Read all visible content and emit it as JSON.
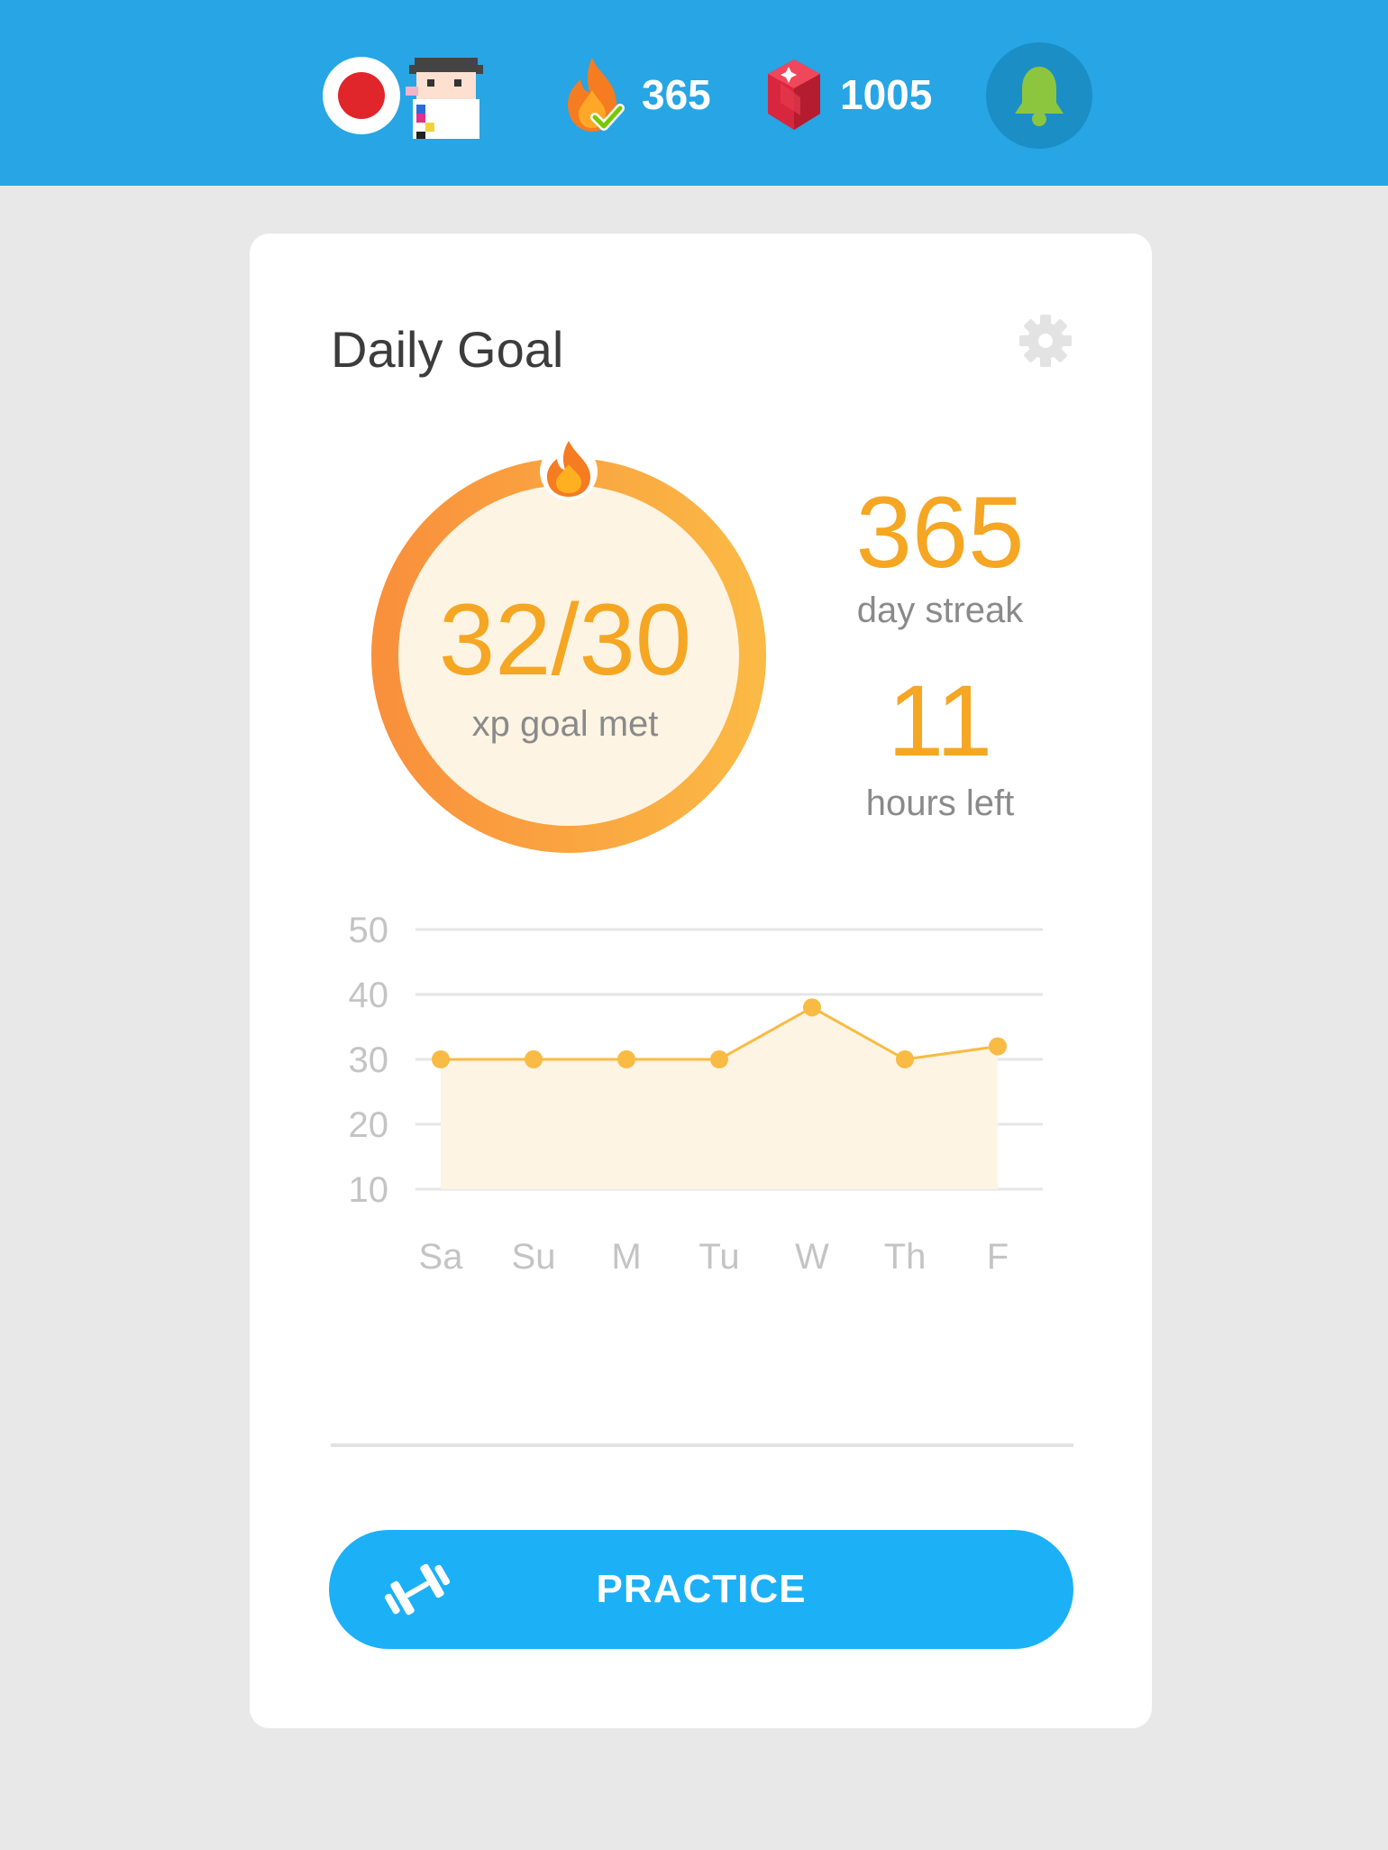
{
  "header": {
    "flag_icon": "japan-flag-icon",
    "avatar_icon": "pixel-avatar-icon",
    "streak": {
      "icon": "flame-check-icon",
      "value": "365"
    },
    "gems": {
      "icon": "red-gem-icon",
      "value": "1005"
    },
    "notifications_icon": "bell-icon",
    "colors": {
      "bar": "#27a5e4",
      "bell_bg": "#1b8ec6"
    }
  },
  "card": {
    "title": "Daily Goal",
    "settings_icon": "gear-icon",
    "progress": {
      "value_text": "32/30",
      "label": "xp goal met",
      "fraction": 1.0,
      "icon": "flame-icon"
    },
    "streak": {
      "value": "365",
      "label": "day streak"
    },
    "hours": {
      "value": "11",
      "label": "hours left"
    },
    "practice_button": {
      "label": "PRACTICE",
      "icon": "dumbbell-icon",
      "color": "#1cb0f6"
    },
    "accent_color": "#f5a623"
  },
  "chart_data": {
    "type": "area",
    "categories": [
      "Sa",
      "Su",
      "M",
      "Tu",
      "W",
      "Th",
      "F"
    ],
    "series": [
      {
        "values": [
          30,
          30,
          30,
          30,
          38,
          30,
          32
        ]
      }
    ],
    "yticks": [
      10,
      20,
      30,
      40,
      50
    ],
    "ylim": [
      10,
      50
    ],
    "grid": true,
    "color": "#f9bb43",
    "fill": "#fef4e3"
  }
}
